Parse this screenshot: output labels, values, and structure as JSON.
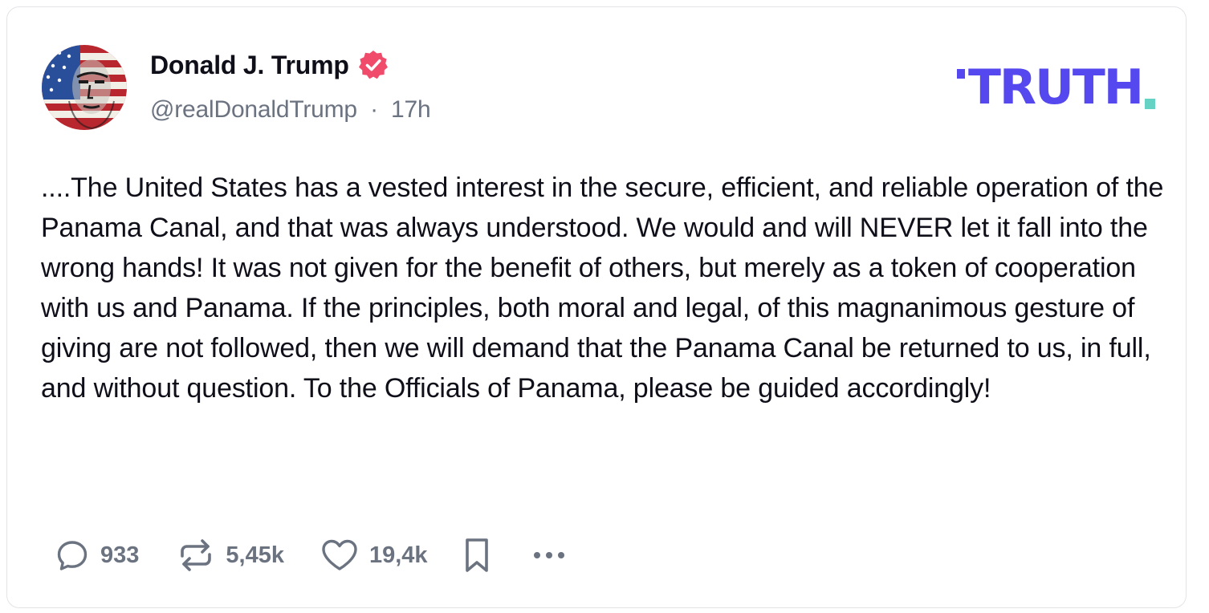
{
  "brand": {
    "wordmark": "TRUTH",
    "primary_color": "#5448ee",
    "dot_color": "#65d2c4"
  },
  "author": {
    "display_name": "Donald J. Trump",
    "handle": "@realDonaldTrump",
    "separator": "·",
    "time": "17h",
    "verified": true,
    "verified_badge_color": "#f04b6b",
    "avatar_icon": "avatar-flag-portrait"
  },
  "post": {
    "text": "....The United States has a vested interest in the secure, efficient, and reliable operation of the Panama Canal, and that was always understood. We would and will NEVER let it fall into the wrong hands! It was not given for the benefit of others, but merely as a token of cooperation with us and Panama. If the principles, both moral and legal, of this magnanimous gesture of giving are not followed, then we will demand that the Panama Canal be returned to us, in full, and without question. To the Officials of Panama, please be guided accordingly!"
  },
  "actions": {
    "reply": {
      "icon": "reply-bubble-icon",
      "count": "933"
    },
    "retruth": {
      "icon": "retruth-icon",
      "count": "5,45k"
    },
    "like": {
      "icon": "heart-icon",
      "count": "19,4k"
    },
    "bookmark": {
      "icon": "bookmark-icon"
    },
    "more": {
      "icon": "more-dots-icon"
    }
  }
}
